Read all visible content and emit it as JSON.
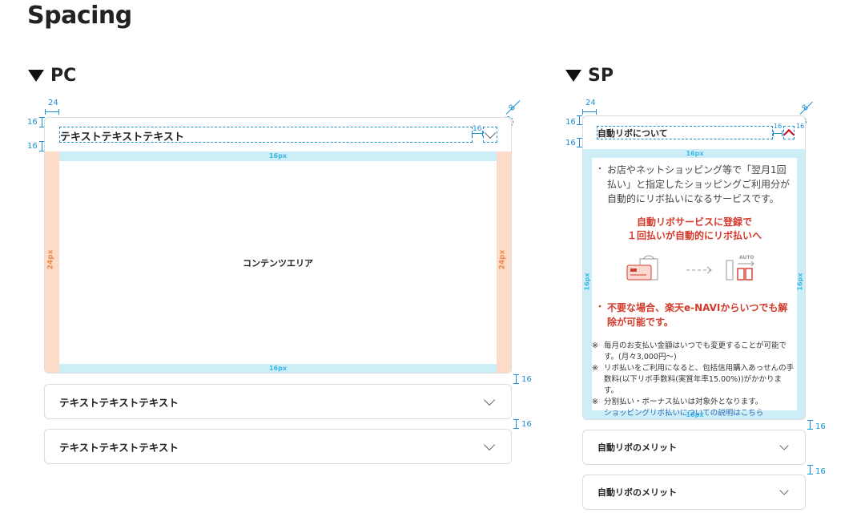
{
  "page_title": "Spacing",
  "pc": {
    "heading": "PC",
    "dims": {
      "left24": "24",
      "top16": "16",
      "bottom16": "16",
      "right16": "16",
      "corner8": "8",
      "gap1": "16",
      "gap2": "16"
    },
    "header_text": "テキストテキストテキスト",
    "side_label": "24px",
    "top_label": "16px",
    "content_label": "コンテンツエリア",
    "accordions": [
      {
        "label": "テキストテキストテキスト"
      },
      {
        "label": "テキストテキストテキスト"
      }
    ]
  },
  "sp": {
    "heading": "SP",
    "dims": {
      "left24": "24",
      "top16": "16",
      "bottom16": "16",
      "right16a": "16",
      "right16b": "16",
      "corner8": "8",
      "gap1": "16",
      "gap2": "16"
    },
    "header_text": "自動リボについて",
    "side_label": "16px",
    "top_label": "16px",
    "bullet1": "お店やネットショッピング等で「翌月1回払い」と指定したショッピングご利用分が自動的にリボ払いになるサービスです。",
    "highlight_line1": "自動リボサービスに登録で",
    "highlight_line2": "１回払いが自動的にリボ払いへ",
    "illus_auto": "AUTO",
    "bullet2": "不要な場合、楽天e-NAVIからいつでも解除が可能です。",
    "notes": [
      "毎月のお支払い金額はいつでも変更することが可能です。(月々3,000円〜)",
      "リボ払いをご利用になると、包括信用購入あっせんの手数料(以下リボ手数料(実質年率15.00%))がかかります。",
      "分割払い・ボーナス払いは対象外となります。"
    ],
    "link": "ショッピングリボ払いについての説明はこちら",
    "accordions": [
      {
        "label": "自動リボのメリット"
      },
      {
        "label": "自動リボのメリット"
      }
    ]
  }
}
